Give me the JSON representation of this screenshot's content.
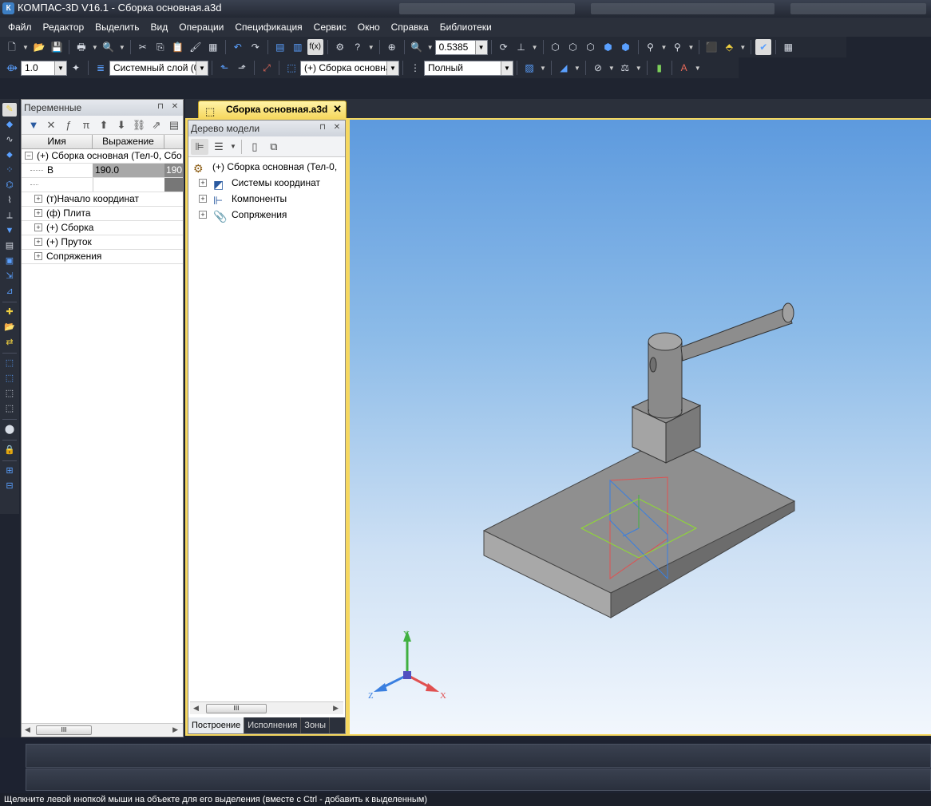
{
  "window": {
    "title": "КОМПАС-3D V16.1 - Сборка основная.a3d",
    "app_icon": "kompas-logo-icon"
  },
  "menu": [
    "Файл",
    "Редактор",
    "Выделить",
    "Вид",
    "Операции",
    "Спецификация",
    "Сервис",
    "Окно",
    "Справка",
    "Библиотеки"
  ],
  "toolbar1": {
    "zoom_value": "0.5385"
  },
  "toolbar2": {
    "line_width": "1.0",
    "layer": "Системный слой (0)",
    "context": "(+) Сборка основна",
    "detail": "Полный"
  },
  "variables": {
    "title": "Переменные",
    "col_name": "Имя",
    "col_expr": "Выражение",
    "root": "(+) Сборка основная (Тел-0, Сбо",
    "var_name": "B",
    "var_expr": "190.0",
    "var_value": "190",
    "items": [
      "(т)Начало координат",
      "(ф) Плита",
      "(+) Сборка",
      "(+) Пруток",
      "Сопряжения"
    ],
    "scroll_thumb": "III"
  },
  "document": {
    "tab_title": "Сборка основная.a3d"
  },
  "tree": {
    "title": "Дерево модели",
    "root": "(+) Сборка основная (Тел-0,",
    "items": [
      "Системы координат",
      "Компоненты",
      "Сопряжения"
    ],
    "tabs": [
      "Построение",
      "Исполнения",
      "Зоны"
    ],
    "scroll_thumb": "III"
  },
  "axes": {
    "x": "X",
    "y": "Y",
    "z": "Z"
  },
  "colors": {
    "accent_tab": "#f6d860",
    "axis_x": "#e05050",
    "axis_y": "#40b040",
    "axis_z": "#3a7fe0"
  },
  "status": "Щелкните левой кнопкой мыши на объекте для его выделения (вместе с Ctrl - добавить к выделенным)"
}
